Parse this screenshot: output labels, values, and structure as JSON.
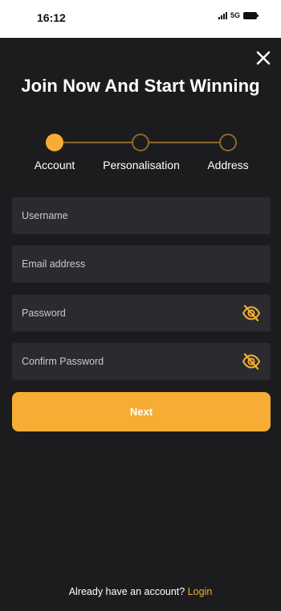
{
  "status_bar": {
    "time": "16:12",
    "network": "5G",
    "signal_icon": "cellular-signal-icon",
    "battery_icon": "battery-icon"
  },
  "dialog": {
    "close_icon": "close-icon",
    "title": "Join Now And Start Winning"
  },
  "stepper": {
    "steps": [
      {
        "label": "Account",
        "state": "active"
      },
      {
        "label": "Personalisation",
        "state": "inactive"
      },
      {
        "label": "Address",
        "state": "inactive"
      }
    ]
  },
  "form": {
    "username": {
      "placeholder": "Username",
      "value": ""
    },
    "email": {
      "placeholder": "Email address",
      "value": ""
    },
    "password": {
      "placeholder": "Password",
      "value": "",
      "toggle_icon": "eye-off-icon"
    },
    "confirm_password": {
      "placeholder": "Confirm Password",
      "value": "",
      "toggle_icon": "eye-off-icon"
    },
    "next_label": "Next"
  },
  "footer": {
    "prompt": "Already have an account?",
    "login_label": "Login"
  },
  "colors": {
    "background": "#1c1c1e",
    "field_background": "#2a2b2f",
    "accent": "#f7ad34",
    "stepper_line": "#8a6a26",
    "text": "#ffffff"
  }
}
